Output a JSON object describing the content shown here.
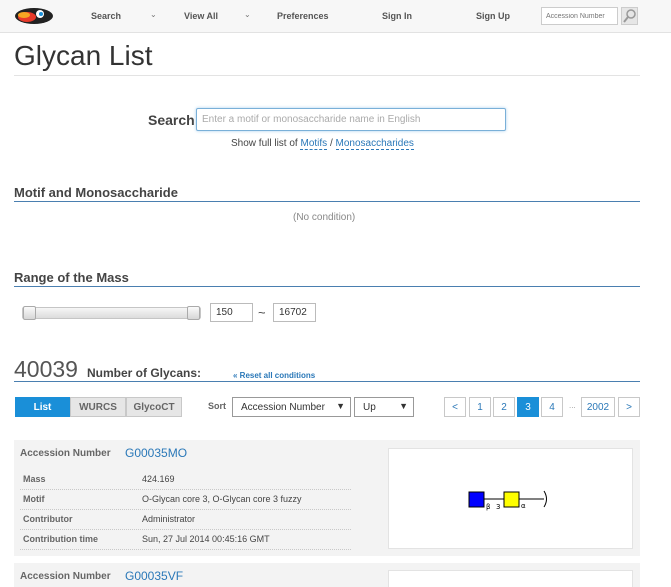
{
  "nav": {
    "items": [
      "Search",
      "View All",
      "Preferences",
      "Sign In",
      "Sign Up"
    ],
    "accession_placeholder": "Accession Number"
  },
  "page": {
    "title": "Glycan List"
  },
  "search": {
    "label": "Search",
    "placeholder": "Enter a motif or monosaccharide name in English",
    "full_list_prefix": "Show full list of",
    "motifs_link": "Motifs",
    "separator": "/",
    "monosaccharides_link": "Monosaccharides"
  },
  "motif_section": {
    "title": "Motif and Monosaccharide",
    "empty_text": "(No condition)"
  },
  "mass_section": {
    "title": "Range of the Mass",
    "min": "150",
    "max": "16702",
    "tilde": "~",
    "slider_range": [
      150,
      16702
    ],
    "slider_value": [
      150,
      16702
    ]
  },
  "results": {
    "count": "40039",
    "count_label": "Number of Glycans:",
    "reset_link": "« Reset all conditions"
  },
  "view_tabs": [
    {
      "label": "List",
      "active": true
    },
    {
      "label": "WURCS",
      "active": false
    },
    {
      "label": "GlycoCT",
      "active": false
    }
  ],
  "sort": {
    "label": "Sort",
    "field": "Accession Number",
    "order": "Up"
  },
  "pagination": {
    "prev": "<",
    "pages": [
      "1",
      "2",
      "3",
      "4"
    ],
    "active_page": "3",
    "ellipsis": "...",
    "last": "2002",
    "next": ">"
  },
  "cards": [
    {
      "accession_label": "Accession Number",
      "accession": "G00035MO",
      "mass_label": "Mass",
      "mass": "424.169",
      "motif_label": "Motif",
      "motif": "O-Glycan core 3, O-Glycan core 3 fuzzy",
      "contributor_label": "Contributor",
      "contributor": "Administrator",
      "time_label": "Contribution time",
      "time": "Sun, 27 Jul 2014 00:45:16 GMT",
      "glycan_labels": [
        "β",
        "3",
        "α"
      ]
    },
    {
      "accession_label": "Accession Number",
      "accession": "G00035VF"
    }
  ],
  "colors": {
    "accent": "#1a8fd8",
    "link": "#2a78b8",
    "glcnac": "#0000ff",
    "gal": "#ffff00"
  }
}
